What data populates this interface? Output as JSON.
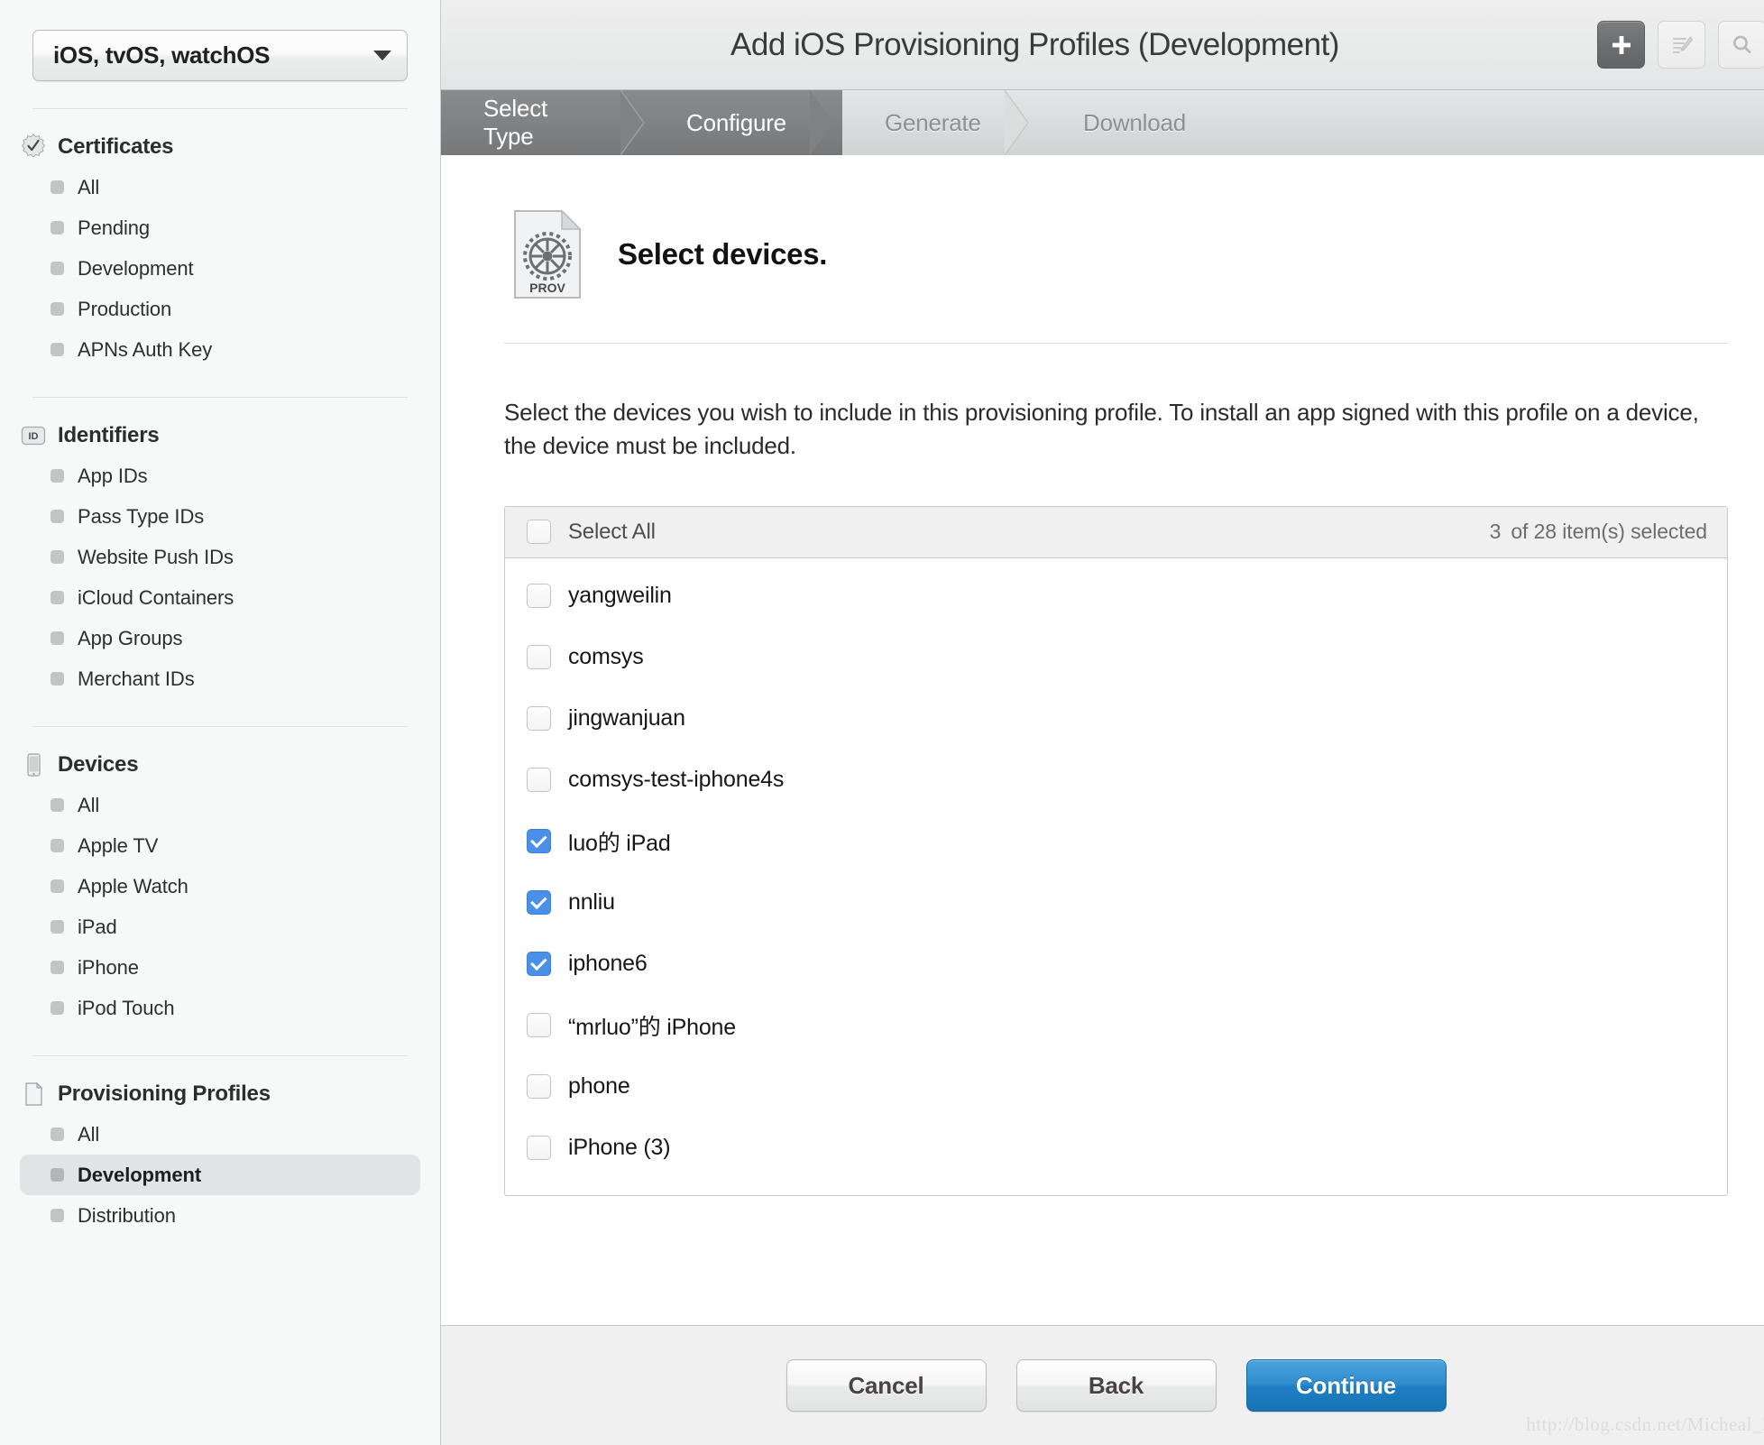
{
  "sidebar": {
    "os_select": {
      "label": "iOS, tvOS, watchOS",
      "caret": "chevron-down-icon"
    },
    "groups": [
      {
        "icon": "certificate-badge-icon",
        "title": "Certificates",
        "items": [
          {
            "label": "All",
            "selected": false
          },
          {
            "label": "Pending",
            "selected": false
          },
          {
            "label": "Development",
            "selected": false
          },
          {
            "label": "Production",
            "selected": false
          },
          {
            "label": "APNs Auth Key",
            "selected": false
          }
        ]
      },
      {
        "icon": "id-badge-icon",
        "title": "Identifiers",
        "items": [
          {
            "label": "App IDs",
            "selected": false
          },
          {
            "label": "Pass Type IDs",
            "selected": false
          },
          {
            "label": "Website Push IDs",
            "selected": false
          },
          {
            "label": "iCloud Containers",
            "selected": false
          },
          {
            "label": "App Groups",
            "selected": false
          },
          {
            "label": "Merchant IDs",
            "selected": false
          }
        ]
      },
      {
        "icon": "device-phone-icon",
        "title": "Devices",
        "items": [
          {
            "label": "All",
            "selected": false
          },
          {
            "label": "Apple TV",
            "selected": false
          },
          {
            "label": "Apple Watch",
            "selected": false
          },
          {
            "label": "iPad",
            "selected": false
          },
          {
            "label": "iPhone",
            "selected": false
          },
          {
            "label": "iPod Touch",
            "selected": false
          }
        ]
      },
      {
        "icon": "document-page-icon",
        "title": "Provisioning Profiles",
        "items": [
          {
            "label": "All",
            "selected": false
          },
          {
            "label": "Development",
            "selected": true
          },
          {
            "label": "Distribution",
            "selected": false
          }
        ]
      }
    ]
  },
  "header": {
    "title": "Add iOS Provisioning Profiles (Development)",
    "actions": [
      {
        "name": "add-button",
        "icon": "plus-icon"
      },
      {
        "name": "edit-button",
        "icon": "edit-pencil-icon"
      },
      {
        "name": "search-button",
        "icon": "search-icon"
      }
    ]
  },
  "steps": [
    {
      "label": "Select Type",
      "state": "done"
    },
    {
      "label": "Configure",
      "state": "active"
    },
    {
      "label": "Generate",
      "state": "todo"
    },
    {
      "label": "Download",
      "state": "todo"
    }
  ],
  "page": {
    "icon_label": "PROV",
    "title": "Select devices.",
    "intro": "Select the devices you wish to include in this provisioning profile. To install an app signed with this profile on a device, the device must be included."
  },
  "devices_table": {
    "select_all_label": "Select All",
    "selected_count": "3",
    "count_text": "of 28 item(s) selected",
    "rows": [
      {
        "label": "yangweilin",
        "checked": false
      },
      {
        "label": "comsys",
        "checked": false
      },
      {
        "label": "jingwanjuan",
        "checked": false
      },
      {
        "label": "comsys-test-iphone4s",
        "checked": false
      },
      {
        "label": "luo的 iPad",
        "checked": true
      },
      {
        "label": "nnliu",
        "checked": true
      },
      {
        "label": "iphone6",
        "checked": true
      },
      {
        "label": "“mrluo”的 iPhone",
        "checked": false
      },
      {
        "label": "phone",
        "checked": false
      },
      {
        "label": "iPhone (3)",
        "checked": false
      }
    ]
  },
  "footer": {
    "cancel_label": "Cancel",
    "back_label": "Back",
    "continue_label": "Continue"
  },
  "watermark": "http://blog.csdn.net/Micheal_ZJ",
  "colors": {
    "accent_blue": "#4a90e8",
    "continue_blue": "#1f7fc4",
    "step_active": "#77787a",
    "sidebar_bg": "#f7f8f8"
  }
}
